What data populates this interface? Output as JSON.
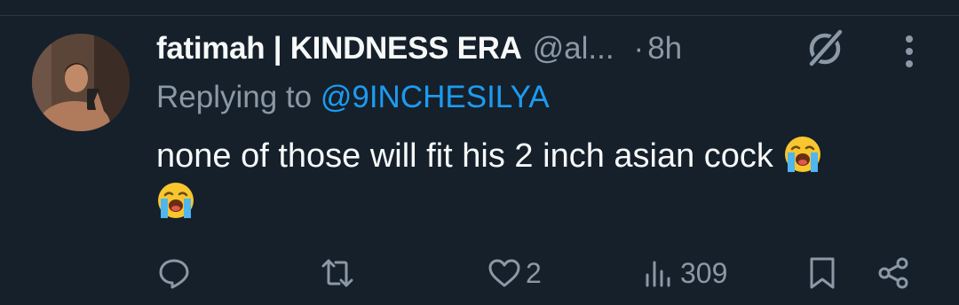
{
  "tweet": {
    "display_name": "fatimah | KINDNESS ERA",
    "handle": "@al...",
    "separator": "·",
    "time": "8h",
    "replying_prefix": "Replying to ",
    "replying_to": "@9INCHESILYA",
    "text": "none of those will fit his 2 inch asian cock",
    "emoji_1": "loudly-crying-face",
    "emoji_2": "loudly-crying-face"
  },
  "actions": {
    "reply_count": "",
    "retweet_count": "",
    "like_count": "2",
    "views_count": "309"
  },
  "colors": {
    "background": "#15202b",
    "text": "#f7f9f9",
    "secondary": "#8b98a5",
    "mention": "#1d9bf0"
  },
  "icons": [
    "reply-icon",
    "retweet-icon",
    "heart-icon",
    "views-icon",
    "bookmark-icon",
    "share-icon",
    "grok-icon",
    "more-icon"
  ]
}
